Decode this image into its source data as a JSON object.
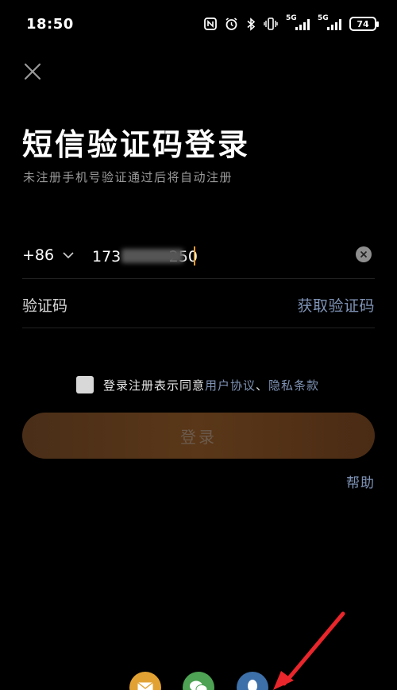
{
  "status_bar": {
    "time": "18:50",
    "battery": "74",
    "net1_label": "5G",
    "net2_label": "5G"
  },
  "header": {
    "title": "短信验证码登录",
    "subtitle": "未注册手机号验证通过后将自动注册"
  },
  "phone": {
    "country_code": "+86",
    "value": "173          250"
  },
  "code": {
    "placeholder": "验证码",
    "get_code_label": "获取验证码"
  },
  "agreement": {
    "prefix": "登录注册表示同意",
    "user_agreement": "用户协议",
    "separator": "、",
    "privacy_terms": "隐私条款"
  },
  "login_button": {
    "label": "登录"
  },
  "help_label": "帮助",
  "colors": {
    "link": "#7f93b6",
    "accent": "#e29c2d",
    "background": "#000000"
  },
  "third_party": [
    {
      "icon": "mail-icon"
    },
    {
      "icon": "wechat-icon"
    },
    {
      "icon": "qq-icon"
    }
  ]
}
